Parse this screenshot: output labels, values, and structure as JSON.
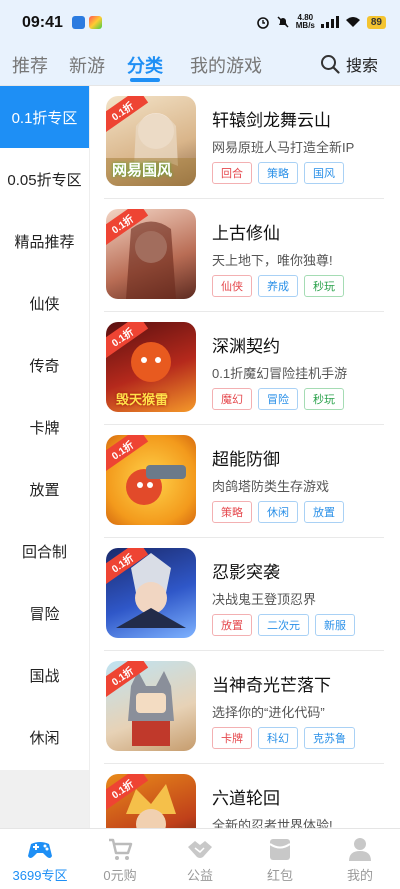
{
  "status_bar": {
    "time": "09:41",
    "network_speed_top": "4.80",
    "network_speed_bottom": "MB/s",
    "signal_label": "5G",
    "battery": "89"
  },
  "top_tabs": [
    {
      "label": "推荐"
    },
    {
      "label": "新游"
    },
    {
      "label": "分类"
    },
    {
      "label": "我的游戏"
    }
  ],
  "search_label": "搜索",
  "sidebar": [
    {
      "label": "0.1折专区"
    },
    {
      "label": "0.05折专区"
    },
    {
      "label": "精品推荐"
    },
    {
      "label": "仙侠"
    },
    {
      "label": "传奇"
    },
    {
      "label": "卡牌"
    },
    {
      "label": "放置"
    },
    {
      "label": "回合制"
    },
    {
      "label": "冒险"
    },
    {
      "label": "国战"
    },
    {
      "label": "休闲"
    }
  ],
  "games": [
    {
      "badge": "0.1折",
      "title": "轩辕剑龙舞云山",
      "desc": "网易原班人马打造全新IP",
      "icon_text": "网易国风",
      "tags": [
        {
          "label": "回合",
          "color": "red"
        },
        {
          "label": "策略",
          "color": "blue"
        },
        {
          "label": "国风",
          "color": "blue"
        }
      ]
    },
    {
      "badge": "0.1折",
      "title": "上古修仙",
      "desc": "天上地下，唯你独尊!",
      "tags": [
        {
          "label": "仙侠",
          "color": "red"
        },
        {
          "label": "养成",
          "color": "blue"
        },
        {
          "label": "秒玩",
          "color": "green"
        }
      ]
    },
    {
      "badge": "0.1折",
      "title": "深渊契约",
      "desc": "0.1折魔幻冒险挂机手游",
      "icon_text": "毁天猴雷",
      "tags": [
        {
          "label": "魔幻",
          "color": "red"
        },
        {
          "label": "冒险",
          "color": "blue"
        },
        {
          "label": "秒玩",
          "color": "green"
        }
      ]
    },
    {
      "badge": "0.1折",
      "title": "超能防御",
      "desc": "肉鸽塔防类生存游戏",
      "tags": [
        {
          "label": "策略",
          "color": "red"
        },
        {
          "label": "休闲",
          "color": "blue"
        },
        {
          "label": "放置",
          "color": "blue"
        }
      ]
    },
    {
      "badge": "0.1折",
      "title": "忍影突袭",
      "desc": "决战鬼王登顶忍界",
      "tags": [
        {
          "label": "放置",
          "color": "red"
        },
        {
          "label": "二次元",
          "color": "blue"
        },
        {
          "label": "新服",
          "color": "blue"
        }
      ]
    },
    {
      "badge": "0.1折",
      "title": "当神奇光芒落下",
      "desc": "选择你的“进化代码”",
      "tags": [
        {
          "label": "卡牌",
          "color": "red"
        },
        {
          "label": "科幻",
          "color": "blue"
        },
        {
          "label": "克苏鲁",
          "color": "blue"
        }
      ]
    },
    {
      "badge": "0.1折",
      "title": "六道轮回",
      "desc": "全新的忍者世界体验!",
      "tags": []
    }
  ],
  "bottom_nav": [
    {
      "label": "3699专区",
      "icon": "gamepad-icon"
    },
    {
      "label": "0元购",
      "icon": "cart-icon"
    },
    {
      "label": "公益",
      "icon": "handshake-icon"
    },
    {
      "label": "红包",
      "icon": "envelope-icon"
    },
    {
      "label": "我的",
      "icon": "person-icon"
    }
  ],
  "colors": {
    "accent": "#1e8ff5",
    "tag_red": "#e5484d",
    "tag_blue": "#2a90e8",
    "tag_green": "#2ba24c"
  }
}
